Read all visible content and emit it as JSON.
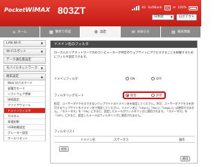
{
  "header": {
    "brand_pocket": "Pocket",
    "brand_wimax": "WiMAX",
    "model": "803ZT",
    "status": {
      "signal": "4G",
      "bank": "SoftBank",
      "network": "4G",
      "battery": "100%"
    },
    "language": "日本語",
    "logout": "ログアウト"
  },
  "nav": {
    "tabs": [
      {
        "label": "ホーム",
        "icon": "home-icon",
        "glyph": "⌂"
      },
      {
        "label": "簡単で作成",
        "icon": "wizard-icon",
        "glyph": "▦"
      },
      {
        "label": "設定",
        "icon": "gear-icon",
        "glyph": "⚙"
      },
      {
        "label": "お知らせ",
        "icon": "mail-icon",
        "glyph": "✉"
      },
      {
        "label": "端末情報",
        "icon": "info-icon",
        "glyph": "▤"
      }
    ]
  },
  "sidebar": {
    "groups": [
      {
        "label": "LAN Wi-Fi"
      },
      {
        "label": "Wi-Fiスポット"
      },
      {
        "label": "データ通信量設定"
      },
      {
        "label": "モバイルネットワーク"
      }
    ],
    "open_group": "端末設定",
    "items": [
      "Web UIパスワード",
      "省電力モード",
      "ソフトウェア更新",
      "接続設定",
      "ファイアウォール",
      "ドメインフィルタ",
      "カスタム",
      "高速起動",
      "USB給電設定",
      "グレーター設定",
      "オールリセット"
    ],
    "active_index": 5
  },
  "main": {
    "title": "ドメイン名のフィルタ",
    "description": "ローカルエリアネットワーク内のコンピューターが特定のウェブサイトにアクセスすることを制御するためにフィルタ設定できます。",
    "filter_label": "ドメインフィルタ",
    "filter_on": "ON",
    "filter_off": "OFF",
    "mode_label": "フィルタリングモード",
    "mode_allow": "拒否",
    "mode_deny": "許可",
    "note": "拒否：ユーザーがアクセスできないウェブサイトのドメイン名を指定してください。許可：ユーザーがアクセスを許可するウェブサイトをドメイン名で指定してください。ドメイン名に「http://」「ftp://」「https://」は使用できません。「ステータス」を「ON」にすると、設定したルールがフィルタリングに適用されます。「ステータス」を「OFF」にすると、設定したルールはフィルタリングに適用されません。",
    "list_label": "フィルタリスト",
    "table_headers": {
      "domain": "ドメイン名",
      "status": "ステータス",
      "action": "操作"
    },
    "add_button": "追加",
    "apply_button": "適用"
  }
}
